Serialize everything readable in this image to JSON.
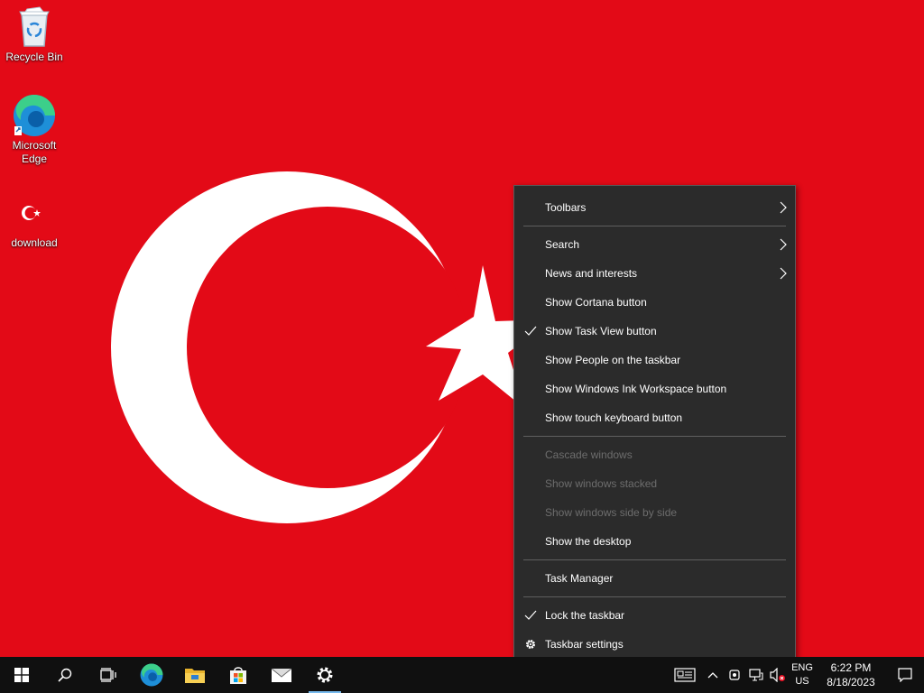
{
  "desktop": {
    "wallpaper_colors": {
      "red": "#e30a17",
      "white": "#ffffff"
    },
    "icons": [
      {
        "label": "Recycle Bin",
        "icon": "recycle-bin-icon"
      },
      {
        "label": "Microsoft Edge",
        "icon": "edge-icon"
      },
      {
        "label": "download",
        "icon": "turkish-flag-image-icon"
      }
    ]
  },
  "context_menu": {
    "items": [
      {
        "label": "Toolbars",
        "has_submenu": true
      },
      {
        "label": "Search",
        "has_submenu": true
      },
      {
        "label": "News and interests",
        "has_submenu": true
      },
      {
        "label": "Show Cortana button"
      },
      {
        "label": "Show Task View button",
        "checked": true
      },
      {
        "label": "Show People on the taskbar"
      },
      {
        "label": "Show Windows Ink Workspace button"
      },
      {
        "label": "Show touch keyboard button"
      },
      {
        "label": "Cascade windows",
        "disabled": true
      },
      {
        "label": "Show windows stacked",
        "disabled": true
      },
      {
        "label": "Show windows side by side",
        "disabled": true
      },
      {
        "label": "Show the desktop"
      },
      {
        "label": "Task Manager"
      },
      {
        "label": "Lock the taskbar",
        "checked": true
      },
      {
        "label": "Taskbar settings",
        "icon": "gear-icon"
      }
    ]
  },
  "taskbar": {
    "apps": [
      {
        "icon": "windows-start-icon"
      },
      {
        "icon": "search-icon"
      },
      {
        "icon": "task-view-icon"
      },
      {
        "icon": "edge-icon"
      },
      {
        "icon": "file-explorer-icon"
      },
      {
        "icon": "microsoft-store-icon"
      },
      {
        "icon": "mail-icon"
      },
      {
        "icon": "settings-gear-icon",
        "active": true
      }
    ],
    "tray": {
      "icons": [
        "news-icon",
        "chevron-up-icon",
        "meet-now-icon",
        "network-icon",
        "volume-muted-icon"
      ],
      "language": {
        "line1": "ENG",
        "line2": "US"
      },
      "time": "6:22 PM",
      "date": "8/18/2023",
      "notification_icon": "action-center-icon"
    },
    "accent_color": "#76b9ed"
  }
}
